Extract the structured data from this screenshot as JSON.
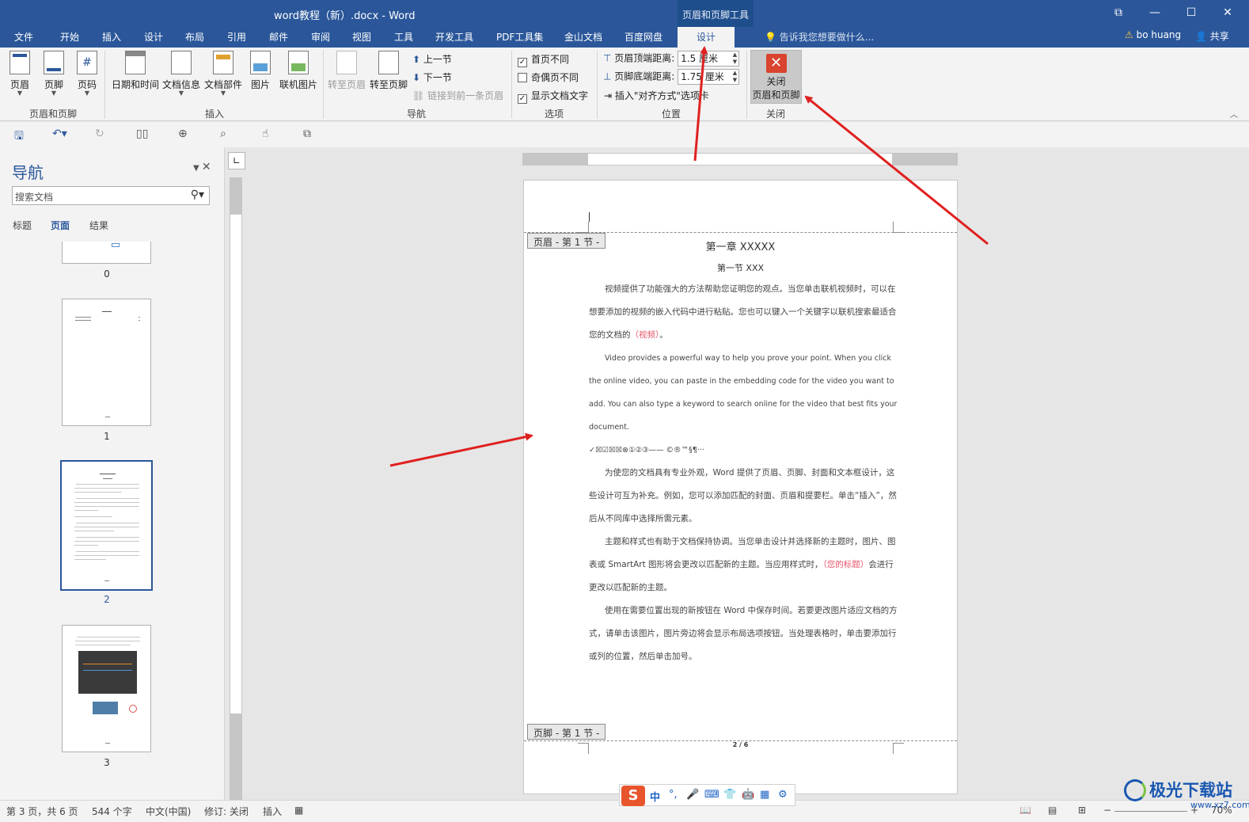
{
  "window": {
    "title": "word教程（新）.docx - Word",
    "context_tab_title": "页眉和页脚工具",
    "buttons": [
      "⧉",
      "—",
      "☐",
      "✕"
    ]
  },
  "menu": {
    "tabs": [
      "文件",
      "开始",
      "插入",
      "设计",
      "布局",
      "引用",
      "邮件",
      "审阅",
      "视图",
      "工具",
      "开发工具",
      "PDF工具集",
      "金山文档",
      "百度网盘"
    ],
    "active_tab": "设计",
    "tell_me": "告诉我您想要做什么...",
    "user": "bo huang",
    "share": "共享"
  },
  "ribbon": {
    "groups": {
      "header_footer": {
        "label": "页眉和页脚",
        "buttons": [
          "页眉",
          "页脚",
          "页码"
        ]
      },
      "insert": {
        "label": "插入",
        "buttons": [
          "日期和时间",
          "文档信息",
          "文档部件",
          "图片",
          "联机图片"
        ]
      },
      "navigation": {
        "label": "导航",
        "goto_header": "转至页眉",
        "goto_footer": "转至页脚",
        "previous": "上一节",
        "next": "下一节",
        "link_previous": "链接到前一条页眉"
      },
      "options": {
        "label": "选项",
        "different_first": {
          "label": "首页不同",
          "checked": true
        },
        "different_odd_even": {
          "label": "奇偶页不同",
          "checked": false
        },
        "show_doc_text": {
          "label": "显示文档文字",
          "checked": true
        }
      },
      "position": {
        "label": "位置",
        "header_top_label": "页眉顶端距离:",
        "header_top_value": "1.5 厘米",
        "footer_bottom_label": "页脚底端距离:",
        "footer_bottom_value": "1.75 厘米",
        "insert_align_tab": "插入\"对齐方式\"选项卡"
      },
      "close": {
        "label": "关闭",
        "button_line1": "关闭",
        "button_line2": "页眉和页脚"
      }
    }
  },
  "nav_pane": {
    "title": "导航",
    "search_placeholder": "搜索文档",
    "tabs": [
      "标题",
      "页面",
      "结果"
    ],
    "active_tab": "页面",
    "pages": [
      "0",
      "1",
      "2",
      "3"
    ],
    "selected_page": "2"
  },
  "page": {
    "header_tag": "页眉 - 第 1 节 -",
    "footer_tag": "页脚 - 第 1 节 -",
    "chapter_title": "第一章  XXXXX",
    "section_title": "第一节  XXX",
    "para1_a": "视频提供了功能强大的方法帮助您证明您的观点。当您单击联机视频时，可以在想要添加的视频的嵌入代码中进行粘贴。您也可以键入一个关键字以联机搜索最适合您的文档的",
    "para1_red": "（视频）",
    "para1_b": "。",
    "para2": "Video provides a powerful way to help you prove your point. When you click the online video, you can paste in the embedding code for the video you want to add. You can also type a keyword to search online for the video that best fits your document.",
    "symbols": "✓☒☑☒☒⊗①②③——       ©®™§¶···",
    "para3": "为使您的文档具有专业外观，Word 提供了页眉、页脚、封面和文本框设计，这些设计可互为补充。例如，您可以添加匹配的封面、页眉和提要栏。单击“插入”，然后从不同库中选择所需元素。",
    "para4_a": "主题和样式也有助于文档保持协调。当您单击设计并选择新的主题时，图片、图表或 SmartArt 图形将会更改以匹配新的主题。当应用样式时，",
    "para4_red": "（您的标题）",
    "para4_b": "会进行更改以匹配新的主题。",
    "para5": "使用在需要位置出现的新按钮在 Word 中保存时间。若要更改图片适应文档的方式，请单击该图片，图片旁边将会显示布局选项按钮。当处理表格时，单击要添加行或列的位置，然后单击加号。",
    "page_number": "2 / 6"
  },
  "status": {
    "page_info": "第 3 页，共 6 页",
    "word_count": "544 个字",
    "language": "中文(中国)",
    "track_changes": "修订: 关闭",
    "insert_mode": "插入",
    "zoom": "70%"
  },
  "ime": {
    "items": [
      "中",
      "°,",
      "🎤",
      "⌨",
      "👕",
      "🤖",
      "▦",
      "⚙"
    ]
  },
  "watermark": {
    "main": "极光下载站",
    "sub": "www.xz7.com"
  },
  "colors": {
    "brand": "#2b579a",
    "arrow": "#e02020",
    "close_icon": "#d9432f"
  }
}
